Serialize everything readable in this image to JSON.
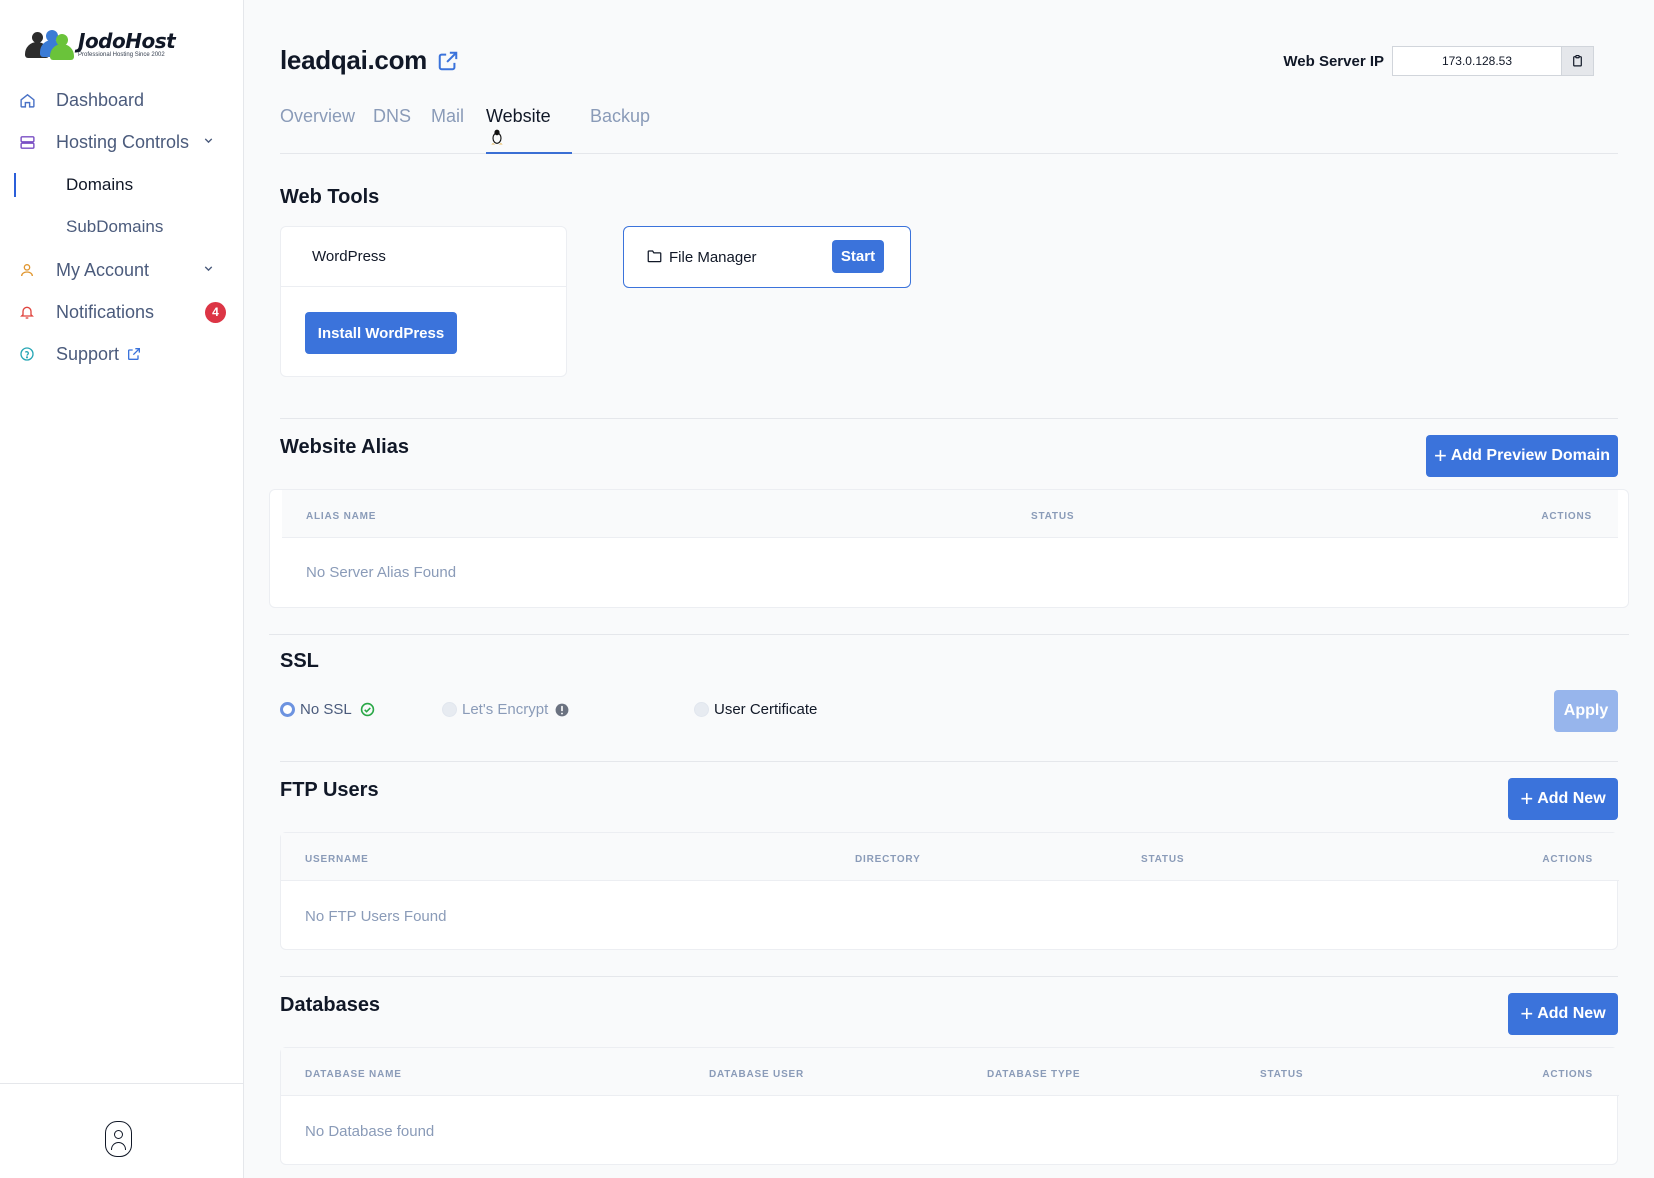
{
  "brand": {
    "name": "JodoHost",
    "tagline": "Professional Hosting Since 2002"
  },
  "sidebar": {
    "items": [
      {
        "label": "Dashboard",
        "icon": "home-icon"
      },
      {
        "label": "Hosting Controls",
        "icon": "server-icon"
      },
      {
        "label": "Domains"
      },
      {
        "label": "SubDomains"
      },
      {
        "label": "My Account",
        "icon": "user-icon"
      },
      {
        "label": "Notifications",
        "icon": "bell-icon",
        "badge": "4"
      },
      {
        "label": "Support",
        "icon": "help-circle-icon"
      }
    ]
  },
  "header": {
    "domain": "leadqai.com",
    "server_ip_label": "Web Server IP",
    "server_ip": "173.0.128.53"
  },
  "tabs": [
    {
      "label": "Overview"
    },
    {
      "label": "DNS"
    },
    {
      "label": "Mail"
    },
    {
      "label": "Website",
      "active": true
    },
    {
      "label": "Backup"
    }
  ],
  "web_tools": {
    "title": "Web Tools",
    "wordpress_label": "WordPress",
    "install_button": "Install WordPress",
    "file_manager_label": "File Manager",
    "start_button": "Start"
  },
  "alias": {
    "title": "Website Alias",
    "add_button": "Add Preview Domain",
    "columns": [
      "ALIAS NAME",
      "STATUS",
      "ACTIONS"
    ],
    "empty": "No Server Alias Found"
  },
  "ssl": {
    "title": "SSL",
    "options": [
      {
        "label": "No SSL",
        "selected": true
      },
      {
        "label": "Let's Encrypt",
        "selected": false
      },
      {
        "label": "User Certificate",
        "selected": false
      }
    ],
    "apply_button": "Apply"
  },
  "ftp": {
    "title": "FTP Users",
    "add_button": "Add New",
    "columns": [
      "USERNAME",
      "DIRECTORY",
      "STATUS",
      "ACTIONS"
    ],
    "empty": "No FTP Users Found"
  },
  "databases": {
    "title": "Databases",
    "add_button": "Add New",
    "columns": [
      "DATABASE NAME",
      "DATABASE USER",
      "DATABASE TYPE",
      "STATUS",
      "ACTIONS"
    ],
    "empty": "No Database found"
  },
  "colors": {
    "accent": "#3b73db",
    "badge": "#dc3545",
    "muted": "#8a9bb8"
  }
}
